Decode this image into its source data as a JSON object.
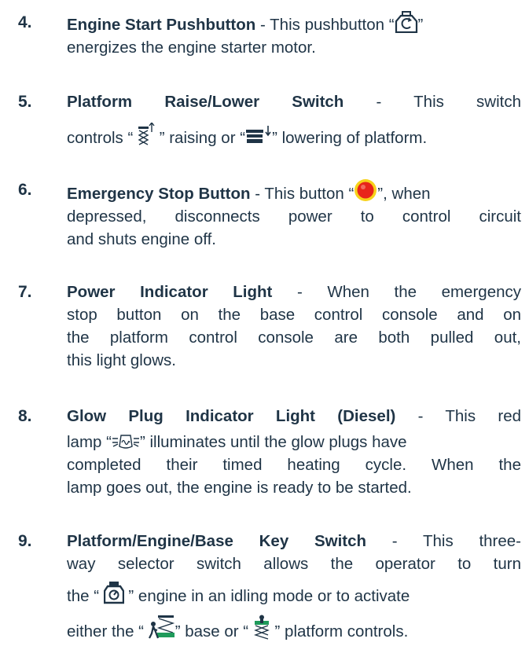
{
  "items": [
    {
      "num": "4.",
      "term": "Engine Start Pushbutton",
      "l1": " - This pushbutton “",
      "l1b": "”",
      "l2": "energizes the engine starter motor.",
      "icon": "engine-start-icon"
    },
    {
      "num": "5.",
      "term": "Platform Raise/Lower Switch",
      "l1": " - This switch",
      "l2a": "controls “ ",
      "l2b": " ” raising or “",
      "l2c": "” lowering of platform.",
      "icons": [
        "platform-raise-icon",
        "platform-lower-icon"
      ]
    },
    {
      "num": "6.",
      "term": "Emergency Stop Button",
      "l1": " - This button “",
      "l1b": "”, when",
      "l2": "depressed, disconnects power to control circuit",
      "l3": "and shuts engine off.",
      "icon": "emergency-stop-icon",
      "icon_color": "#e8241a"
    },
    {
      "num": "7.",
      "term": "Power Indicator Light",
      "l1": " - When the emergency",
      "l2": "stop button on the base control console and on",
      "l3": "the platform control console are both pulled out,",
      "l4": "this light glows."
    },
    {
      "num": "8.",
      "term": "Glow Plug Indicator Light (Diesel)",
      "l1": " - This red",
      "l2a": "lamp “",
      "l2b": "” illuminates until the glow plugs have",
      "l3": "completed their timed heating cycle. When the",
      "l4": "lamp goes out, the engine is ready to be started.",
      "icon": "glow-plug-icon"
    },
    {
      "num": "9.",
      "term": "Platform/Engine/Base Key Switch",
      "l1": " - This three-",
      "l2": "way selector switch allows the operator to turn",
      "l3a": "the “ ",
      "l3b": " ” engine in an idling mode or to activate",
      "l4a": "either the “ ",
      "l4b": "” base or “ ",
      "l4c": " ” platform controls.",
      "icons": [
        "engine-idle-icon",
        "base-control-icon",
        "platform-control-icon"
      ],
      "icon_color": "#1f9a5a"
    }
  ]
}
